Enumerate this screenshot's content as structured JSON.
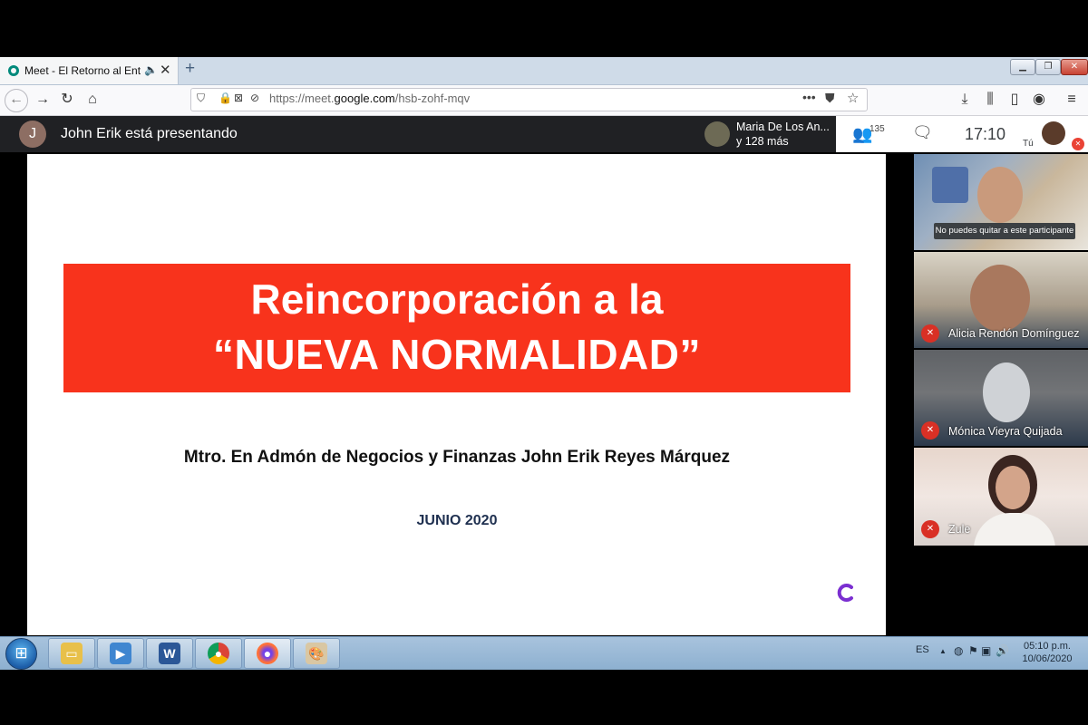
{
  "browser": {
    "tab_title": "Meet - El Retorno al Entretenimiento",
    "url_prefix": "https://meet.",
    "url_domain": "google.com",
    "url_path": "/hsb-zohf-mqv"
  },
  "meet": {
    "presenter_initial": "J",
    "presenting_text": "John Erik está presentando",
    "chip_name": "Maria De Los An...",
    "chip_more": "y 128 más",
    "participant_count": "135",
    "clock": "17:10",
    "you_label": "Tú"
  },
  "slide": {
    "title_line1": "Reincorporación a la",
    "title_line2": "“NUEVA NORMALIDAD”",
    "author": "Mtro. En Admón de Negocios y Finanzas John Erik Reyes Márquez",
    "date": "JUNIO 2020",
    "banner_color": "#f8331c",
    "logo_color": "#7b2fd1"
  },
  "participants": [
    {
      "tooltip": "No puedes quitar a este participante"
    },
    {
      "name": "Alicia Rendón Domínguez",
      "muted": true
    },
    {
      "name": "Mónica Vieyra Quijada",
      "muted": true
    },
    {
      "name": "Zule",
      "muted": true
    }
  ],
  "taskbar": {
    "language": "ES",
    "time": "05:10 p.m.",
    "date": "10/06/2020"
  }
}
